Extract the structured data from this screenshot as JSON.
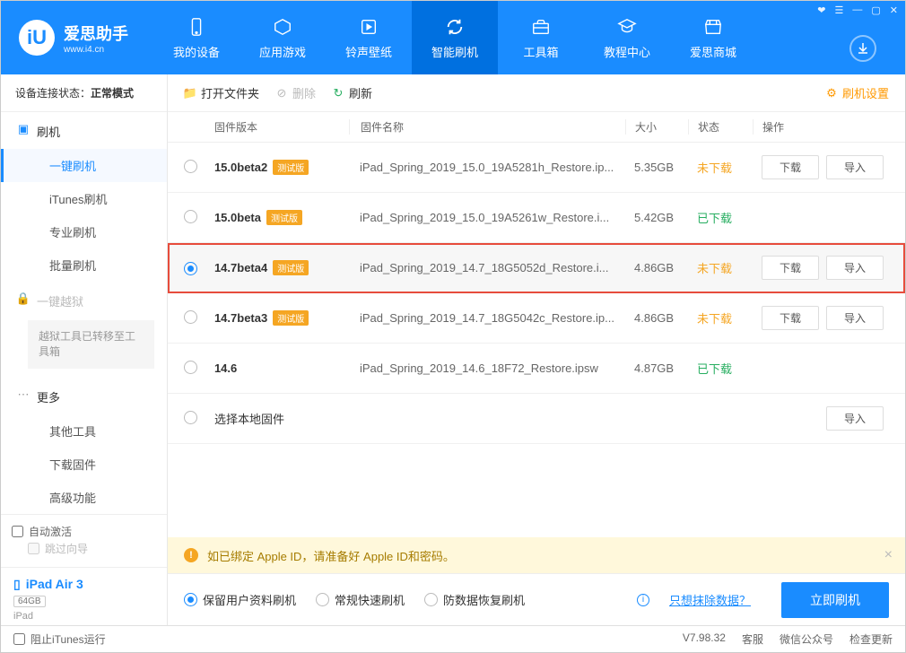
{
  "brand": {
    "name": "爱思助手",
    "url": "www.i4.cn",
    "logo_letter": "iU"
  },
  "nav": {
    "items": [
      {
        "label": "我的设备",
        "icon": "device"
      },
      {
        "label": "应用游戏",
        "icon": "apps"
      },
      {
        "label": "铃声壁纸",
        "icon": "media"
      },
      {
        "label": "智能刷机",
        "icon": "flash",
        "active": true
      },
      {
        "label": "工具箱",
        "icon": "toolbox"
      },
      {
        "label": "教程中心",
        "icon": "tutorial"
      },
      {
        "label": "爱思商城",
        "icon": "store"
      }
    ]
  },
  "sidebar": {
    "conn_label": "设备连接状态：",
    "conn_value": "正常模式",
    "section_flash": {
      "title": "刷机",
      "items": [
        "一键刷机",
        "iTunes刷机",
        "专业刷机",
        "批量刷机"
      ]
    },
    "section_jail": {
      "title": "一键越狱",
      "note": "越狱工具已转移至工具箱"
    },
    "section_more": {
      "title": "更多",
      "items": [
        "其他工具",
        "下载固件",
        "高级功能"
      ]
    },
    "auto_activate": "自动激活",
    "skip_guide": "跳过向导",
    "device": {
      "name": "iPad Air 3",
      "storage": "64GB",
      "model": "iPad"
    }
  },
  "toolbar": {
    "open_folder": "打开文件夹",
    "delete": "删除",
    "refresh": "刷新",
    "settings": "刷机设置"
  },
  "table": {
    "headers": {
      "version": "固件版本",
      "name": "固件名称",
      "size": "大小",
      "status": "状态",
      "ops": "操作"
    },
    "btn_download": "下载",
    "btn_import": "导入",
    "status_not": "未下载",
    "status_done": "已下载",
    "beta_badge": "测试版",
    "local_label": "选择本地固件",
    "rows": [
      {
        "ver": "15.0beta2",
        "beta": true,
        "name": "iPad_Spring_2019_15.0_19A5281h_Restore.ip...",
        "size": "5.35GB",
        "status": "not",
        "selected": false,
        "show_dl": true
      },
      {
        "ver": "15.0beta",
        "beta": true,
        "name": "iPad_Spring_2019_15.0_19A5261w_Restore.i...",
        "size": "5.42GB",
        "status": "done",
        "selected": false,
        "show_dl": false
      },
      {
        "ver": "14.7beta4",
        "beta": true,
        "name": "iPad_Spring_2019_14.7_18G5052d_Restore.i...",
        "size": "4.86GB",
        "status": "not",
        "selected": true,
        "show_dl": true,
        "highlight": true
      },
      {
        "ver": "14.7beta3",
        "beta": true,
        "name": "iPad_Spring_2019_14.7_18G5042c_Restore.ip...",
        "size": "4.86GB",
        "status": "not",
        "selected": false,
        "show_dl": true
      },
      {
        "ver": "14.6",
        "beta": false,
        "name": "iPad_Spring_2019_14.6_18F72_Restore.ipsw",
        "size": "4.87GB",
        "status": "done",
        "selected": false,
        "show_dl": false
      }
    ]
  },
  "notice": "如已绑定 Apple ID，请准备好 Apple ID和密码。",
  "options": {
    "opt1": "保留用户资料刷机",
    "opt2": "常规快速刷机",
    "opt3": "防数据恢复刷机",
    "link": "只想抹除数据？",
    "action": "立即刷机"
  },
  "footer": {
    "block_itunes": "阻止iTunes运行",
    "version": "V7.98.32",
    "links": [
      "客服",
      "微信公众号",
      "检查更新"
    ]
  }
}
